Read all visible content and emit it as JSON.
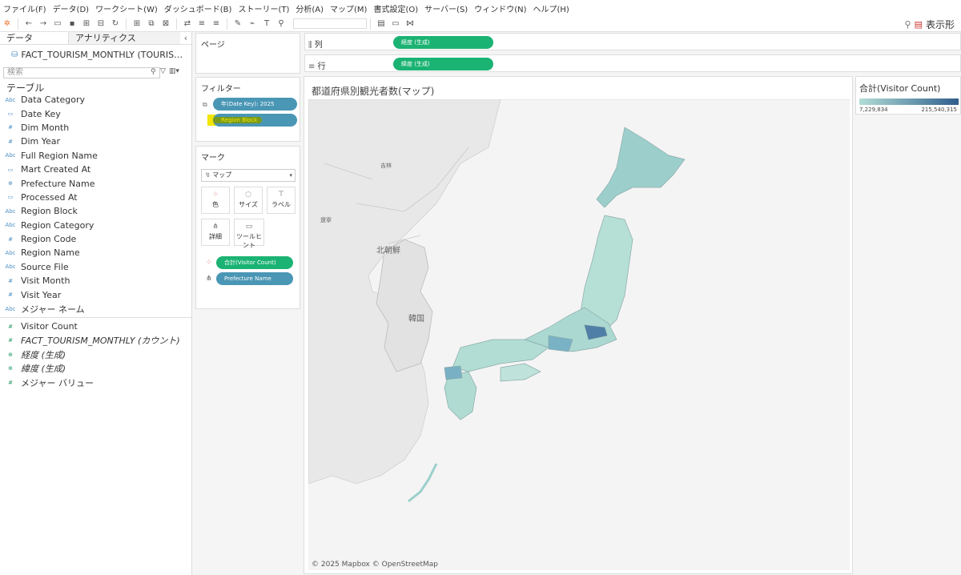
{
  "menu": [
    "ファイル(F)",
    "データ(D)",
    "ワークシート(W)",
    "ダッシュボード(B)",
    "ストーリー(T)",
    "分析(A)",
    "マップ(M)",
    "書式設定(O)",
    "サーバー(S)",
    "ウィンドウ(N)",
    "ヘルプ(H)"
  ],
  "toolbar": {
    "show_me_label": "表示形"
  },
  "left_pane": {
    "tab_data": "データ",
    "tab_analytics": "アナリティクス",
    "datasource": "FACT_TOURISM_MONTHLY (TOURIS…",
    "search_placeholder": "検索",
    "table_header": "テーブル",
    "dimensions": [
      {
        "icon": "Abc",
        "label": "Data Category"
      },
      {
        "icon": "▭",
        "label": "Date Key"
      },
      {
        "icon": "#",
        "label": "Dim Month"
      },
      {
        "icon": "#",
        "label": "Dim Year"
      },
      {
        "icon": "Abc",
        "label": "Full Region Name"
      },
      {
        "icon": "▭",
        "label": "Mart Created At"
      },
      {
        "icon": "⊕",
        "label": "Prefecture Name"
      },
      {
        "icon": "▭",
        "label": "Processed At"
      },
      {
        "icon": "Abc",
        "label": "Region Block"
      },
      {
        "icon": "Abc",
        "label": "Region Category"
      },
      {
        "icon": "#",
        "label": "Region Code"
      },
      {
        "icon": "Abc",
        "label": "Region Name"
      },
      {
        "icon": "Abc",
        "label": "Source File"
      },
      {
        "icon": "#",
        "label": "Visit Month"
      },
      {
        "icon": "#",
        "label": "Visit Year"
      },
      {
        "icon": "Abc",
        "label": "メジャー ネーム"
      }
    ],
    "measures": [
      {
        "icon": "#",
        "label": "Visitor Count"
      },
      {
        "icon": "#",
        "label": "FACT_TOURISM_MONTHLY (カウント)"
      },
      {
        "icon": "⊕",
        "label": "経度 (生成)"
      },
      {
        "icon": "⊕",
        "label": "緯度 (生成)"
      },
      {
        "icon": "#",
        "label": "メジャー バリュー"
      }
    ]
  },
  "cards": {
    "pages_title": "ページ",
    "filters_title": "フィルター",
    "filter_pills": [
      "年(Date Key): 2025",
      "Region Block"
    ],
    "marks_title": "マーク",
    "mark_type": "マップ",
    "mark_buttons": [
      "色",
      "サイズ",
      "ラベル",
      "詳細",
      "ツールヒント"
    ],
    "mark_pills": [
      "合計(Visitor Count)",
      "Prefecture Name"
    ]
  },
  "shelves": {
    "columns_label": "列",
    "columns_pill": "経度 (生成)",
    "rows_label": "行",
    "rows_pill": "緯度 (生成)"
  },
  "sheet": {
    "title": "都道府県別観光者数(マップ)",
    "map_labels": [
      "吉林",
      "北朝鮮",
      "韓国",
      "遼寧"
    ],
    "copyright": "© 2025 Mapbox © OpenStreetMap"
  },
  "legend": {
    "title": "合計(Visitor Count)",
    "min": "7,229,834",
    "max": "215,540,315",
    "color_low": "#b2ded6",
    "color_high": "#2e5d8c"
  }
}
